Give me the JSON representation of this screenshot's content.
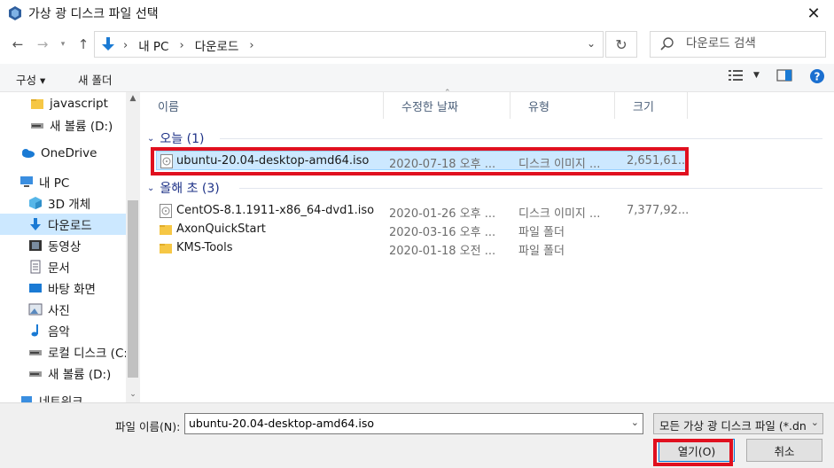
{
  "window": {
    "title": "가상 광 디스크 파일 선택"
  },
  "nav": {
    "breadcrumbs": [
      "내 PC",
      "다운로드"
    ],
    "search_placeholder": "다운로드 검색"
  },
  "toolbar": {
    "organize_label": "구성 ▾",
    "new_folder_label": "새 폴더"
  },
  "sidebar": {
    "items": [
      {
        "label": "javascript",
        "icon": "folder-icon"
      },
      {
        "label": "새 볼륨 (D:)",
        "icon": "drive-icon"
      },
      {
        "label": "OneDrive",
        "icon": "cloud-icon"
      },
      {
        "label": "내 PC",
        "icon": "pc-icon"
      },
      {
        "label": "3D 개체",
        "icon": "cube-icon"
      },
      {
        "label": "다운로드",
        "icon": "download-icon"
      },
      {
        "label": "동영상",
        "icon": "video-icon"
      },
      {
        "label": "문서",
        "icon": "document-icon"
      },
      {
        "label": "바탕 화면",
        "icon": "desktop-icon"
      },
      {
        "label": "사진",
        "icon": "pictures-icon"
      },
      {
        "label": "음악",
        "icon": "music-icon"
      },
      {
        "label": "로컬 디스크 (C:)",
        "icon": "drive-icon"
      },
      {
        "label": "새 볼륨 (D:)",
        "icon": "drive-icon"
      },
      {
        "label": "네트워크",
        "icon": "network-icon"
      }
    ]
  },
  "columns": {
    "name": "이름",
    "modified": "수정한 날짜",
    "type": "유형",
    "size": "크기"
  },
  "groups": [
    {
      "label": "오늘 (1)",
      "files": [
        {
          "name": "ubuntu-20.04-desktop-amd64.iso",
          "modified": "2020-07-18 오후 ...",
          "type": "디스크 이미지 ...",
          "size": "2,651,61...",
          "icon": "disc-image-icon"
        }
      ]
    },
    {
      "label": "올해 초 (3)",
      "files": [
        {
          "name": "CentOS-8.1.1911-x86_64-dvd1.iso",
          "modified": "2020-01-26 오후 ...",
          "type": "디스크 이미지 ...",
          "size": "7,377,92...",
          "icon": "disc-image-icon"
        },
        {
          "name": "AxonQuickStart",
          "modified": "2020-03-16 오후 ...",
          "type": "파일 폴더",
          "size": "",
          "icon": "folder-icon"
        },
        {
          "name": "KMS-Tools",
          "modified": "2020-01-18 오전 ...",
          "type": "파일 폴더",
          "size": "",
          "icon": "folder-icon"
        }
      ]
    }
  ],
  "footer": {
    "filename_label": "파일 이름(N):",
    "filename_value": "ubuntu-20.04-desktop-amd64.iso",
    "filetype_value": "모든 가상 광 디스크 파일 (*.dn",
    "open_label": "열기(O)",
    "cancel_label": "취소"
  },
  "colors": {
    "selection": "#cce8ff",
    "highlight": "#e0101f",
    "group_text": "#1e3287"
  }
}
